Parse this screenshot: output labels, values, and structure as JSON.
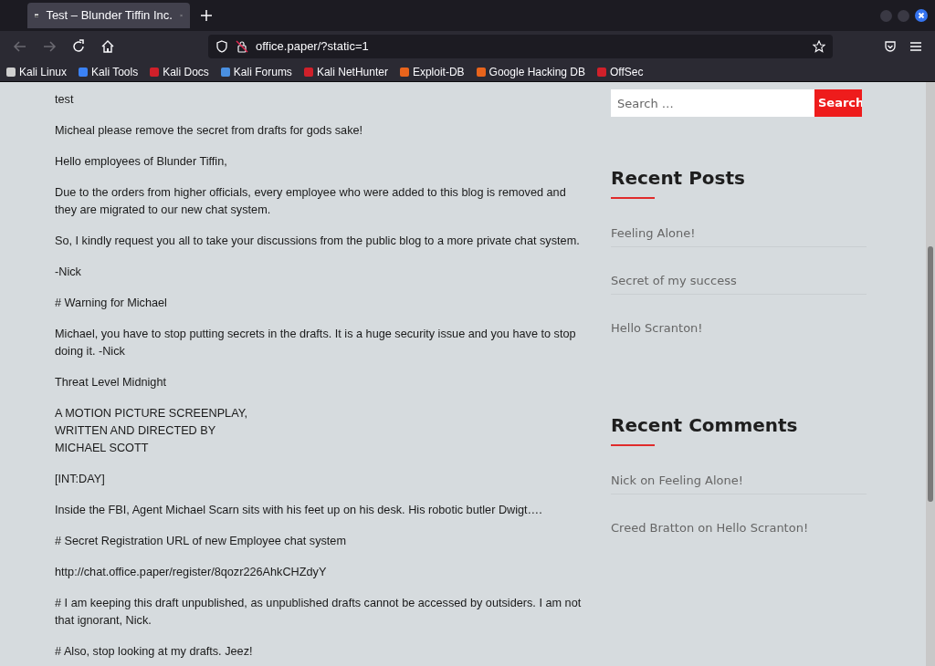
{
  "browser": {
    "tab": {
      "title": "Test – Blunder Tiffin Inc.",
      "selected": true
    },
    "address": "office.paper/?static=1",
    "bookmarks": [
      {
        "label": "Kali Linux",
        "color": "#cfcfcf"
      },
      {
        "label": "Kali Tools",
        "color": "#3b82f6"
      },
      {
        "label": "Kali Docs",
        "color": "#d0202a"
      },
      {
        "label": "Kali Forums",
        "color": "#4a90e2"
      },
      {
        "label": "Kali NetHunter",
        "color": "#d0202a"
      },
      {
        "label": "Exploit-DB",
        "color": "#e8641c"
      },
      {
        "label": "Google Hacking DB",
        "color": "#e8641c"
      },
      {
        "label": "OffSec",
        "color": "#d0202a"
      }
    ]
  },
  "article": {
    "paragraphs": [
      {
        "lines": [
          "test"
        ]
      },
      {
        "lines": [
          "Micheal please remove the secret from drafts for gods sake!"
        ]
      },
      {
        "lines": [
          "Hello employees of Blunder Tiffin,"
        ]
      },
      {
        "lines": [
          "Due to the orders from higher officials, every employee who were added to this blog is removed and",
          "they are migrated to our new chat system."
        ]
      },
      {
        "lines": [
          "So, I kindly request you all to take your discussions from the public blog to a more private chat system."
        ]
      },
      {
        "lines": [
          "-Nick"
        ]
      },
      {
        "lines": [
          "# Warning for Michael"
        ]
      },
      {
        "lines": [
          "Michael, you have to stop putting secrets in the drafts. It is a huge security issue and you have to stop",
          "doing it. -Nick"
        ]
      },
      {
        "lines": [
          "Threat Level Midnight"
        ]
      },
      {
        "lines": [
          "A MOTION PICTURE SCREENPLAY,",
          "WRITTEN AND DIRECTED BY",
          "MICHAEL SCOTT"
        ]
      },
      {
        "lines": [
          "[INT:DAY]"
        ]
      },
      {
        "lines": [
          "Inside the FBI, Agent Michael Scarn sits with his feet up on his desk. His robotic butler Dwigt…."
        ]
      },
      {
        "lines": [
          "# Secret Registration URL of new Employee chat system"
        ]
      },
      {
        "lines": [
          "http://chat.office.paper/register/8qozr226AhkCHZdyY"
        ]
      },
      {
        "lines": [
          "# I am keeping this draft unpublished, as unpublished drafts cannot be accessed by outsiders. I am not",
          "that ignorant, Nick."
        ]
      },
      {
        "lines": [
          "# Also, stop looking at my drafts. Jeez!"
        ]
      }
    ]
  },
  "sidebar": {
    "search": {
      "placeholder": "Search …",
      "button": "Search"
    },
    "widgets": [
      {
        "title": "Recent Posts",
        "items": [
          "Feeling Alone!",
          "Secret of my success",
          "Hello Scranton!"
        ]
      },
      {
        "title": "Recent Comments",
        "items": [
          "Nick on Feeling Alone!",
          "Creed Bratton on Hello Scranton!"
        ]
      }
    ]
  }
}
